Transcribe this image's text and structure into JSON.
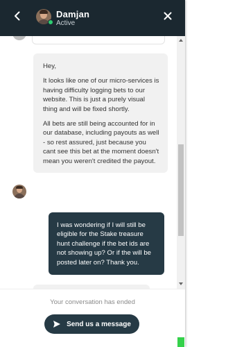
{
  "header": {
    "agent_name": "Damjan",
    "agent_status": "Active",
    "back_icon": "chevron-left-icon",
    "close_icon": "close-icon"
  },
  "messages": [
    {
      "sender": "agent",
      "paragraphs": [
        "Hey,",
        "It looks like one of our micro-services is having difficulty logging bets to our website. This is just a purely visual thing and will be fixed shortly.",
        "All bets are still being accounted for in our database, including payouts as well - so rest assured, just because you cant see this bet at the moment doesn't mean you weren't credited the payout."
      ]
    },
    {
      "sender": "user",
      "text": "I was wondering if I will still be eligible for the Stake treasure hunt challenge if the bet ids are not showing up? Or if the will be posted later on? Thank you."
    }
  ],
  "footer": {
    "ended_text": "Your conversation has ended",
    "send_label": "Send us a message",
    "send_icon": "send-icon"
  },
  "colors": {
    "header_bg": "#1b2830",
    "user_bubble": "#263a45",
    "agent_bubble": "#f1f1f1",
    "online": "#2ecc71"
  }
}
